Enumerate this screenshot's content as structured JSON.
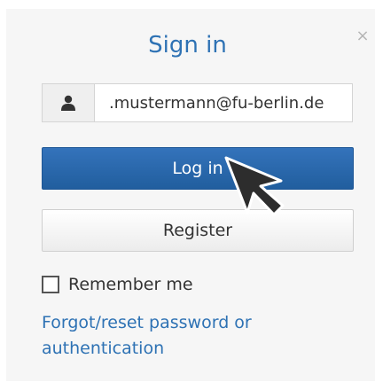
{
  "dialog": {
    "title": "Sign in",
    "close_glyph": "×"
  },
  "login": {
    "username_value": ".mustermann@fu-berlin.de",
    "user_icon": "user-icon",
    "login_label": "Log in",
    "register_label": "Register",
    "remember_label": "Remember me",
    "remember_checked": false,
    "forgot_link": "Forgot/reset password or authentication"
  },
  "colors": {
    "accent": "#2e72b4",
    "primary_button": "#2a69ad"
  }
}
